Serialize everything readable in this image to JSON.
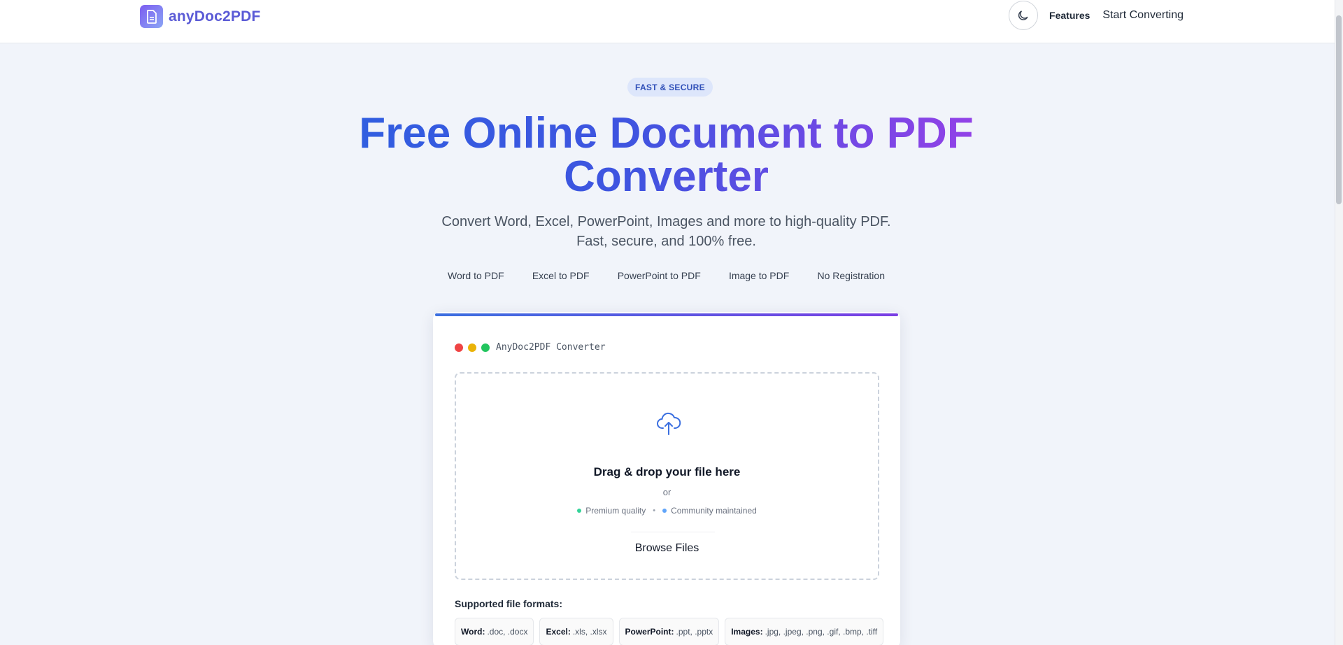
{
  "header": {
    "logo_text": "anyDoc2PDF",
    "nav_features": "Features",
    "nav_start": "Start Converting"
  },
  "hero": {
    "badge": "FAST & SECURE",
    "title_line1": "Free Online Document to PDF",
    "title_line2": "Converter",
    "subtitle_line1": "Convert Word, Excel, PowerPoint, Images and more to high-quality PDF.",
    "subtitle_line2": "Fast, secure, and 100% free.",
    "features": [
      "Word to PDF",
      "Excel to PDF",
      "PowerPoint to PDF",
      "Image to PDF",
      "No Registration"
    ]
  },
  "converter": {
    "window_title": "AnyDoc2PDF Converter",
    "drop_title": "Drag & drop your file here",
    "or": "or",
    "meta_left": "Premium quality",
    "meta_right": "Community maintained",
    "browse_label": "Browse Files",
    "formats_label": "Supported file formats:",
    "formats": [
      {
        "name": "Word:",
        "ext": ".doc, .docx"
      },
      {
        "name": "Excel:",
        "ext": ".xls, .xlsx"
      },
      {
        "name": "PowerPoint:",
        "ext": ".ppt, .pptx"
      },
      {
        "name": "Images:",
        "ext": ".jpg, .jpeg, .png, .gif, .bmp, .tiff"
      }
    ]
  },
  "colors": {
    "accent_blue": "#2f5fe0",
    "accent_purple": "#9b3fe8",
    "dot_red": "#ef4444",
    "dot_yellow": "#eab308",
    "dot_green": "#22c55e"
  },
  "icons": {
    "logo": "document-icon",
    "theme": "moon-icon",
    "upload": "cloud-upload-icon"
  }
}
